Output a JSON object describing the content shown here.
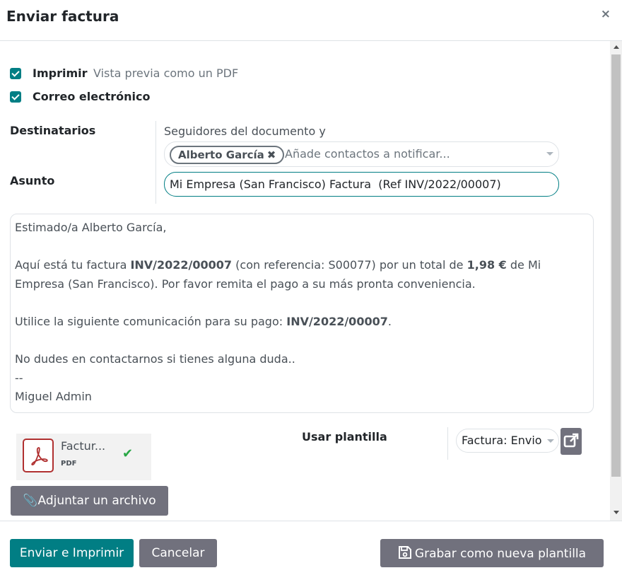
{
  "dialog": {
    "title": "Enviar factura",
    "close_symbol": "×"
  },
  "options": {
    "print_label": "Imprimir",
    "print_hint": "Vista previa como un PDF",
    "email_label": "Correo electrónico"
  },
  "recipients": {
    "label": "Destinatarios",
    "intro": "Seguidores del documento y",
    "tag": "Alberto García",
    "tag_remove_symbol": "✖",
    "placeholder": "Añade contactos a notificar..."
  },
  "subject": {
    "label": "Asunto",
    "value": "Mi Empresa (San Francisco) Factura  (Ref INV/2022/00007)"
  },
  "body": {
    "greeting": "Estimado/a Alberto García,",
    "p1_pre": "Aquí está tu factura ",
    "p1_invoice": "INV/2022/00007",
    "p1_mid": " (con referencia: S00077) por un total de ",
    "p1_amount": "1,98 €",
    "p1_post": " de Mi Empresa (San Francisco). Por favor remita el pago a su más pronta conveniencia.",
    "p2_pre": "Utilice la siguiente comunicación para su pago: ",
    "p2_ref": "INV/2022/00007",
    "p2_post": ".",
    "p3": "No dudes en contactarnos si tienes alguna duda..",
    "signature_sep": "--",
    "signature": "Miguel Admin"
  },
  "attachment": {
    "name": "Factur...",
    "ext": "PDF",
    "status_icon": "check-icon"
  },
  "template": {
    "label": "Usar plantilla",
    "selected": "Factura: Envio"
  },
  "buttons": {
    "attach": "Adjuntar un archivo",
    "send_print": "Enviar e Imprimir",
    "cancel": "Cancelar",
    "save_template": "Grabar como nueva plantilla"
  },
  "colors": {
    "primary": "#017e84",
    "secondary": "#71717d",
    "success": "#28a745",
    "pdf_red": "#b03030"
  }
}
